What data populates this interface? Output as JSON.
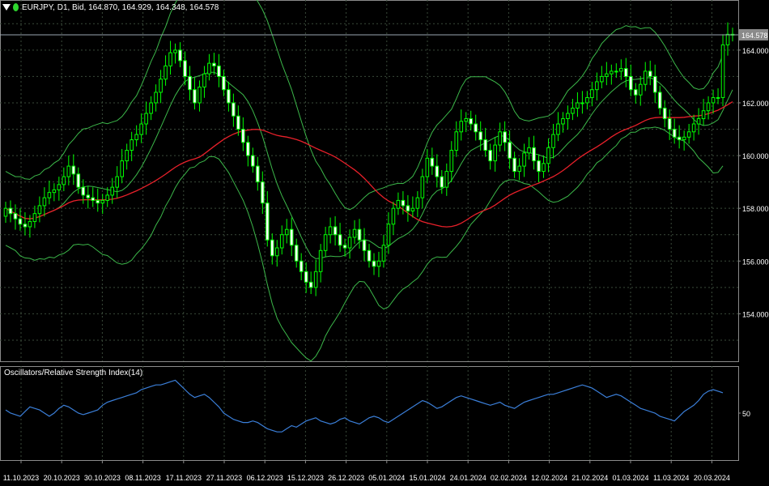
{
  "header": {
    "symbol": "EURJPY",
    "timeframe": "D1",
    "price_type": "Bid",
    "ohlc_text": "EURJPY, D1, Bid, 164.870, 164.929, 164.348, 164.578"
  },
  "oscillator_label": "Oscillators/Relative Strength Index(14)",
  "current_price_label": "164.578",
  "colors": {
    "background": "#000000",
    "grid": "#3a4a3a",
    "candle": "#00ff00",
    "bollinger": "#3cb84a",
    "ma": "#e8202a",
    "rsi": "#3b7fd9",
    "price_tag_bg": "#8a8a8a"
  },
  "chart_data": [
    {
      "type": "candlestick",
      "title": "EURJPY, D1, Bid",
      "ylim": [
        152.2,
        165.9
      ],
      "y_ticks": [
        154.0,
        156.0,
        158.0,
        160.0,
        162.0,
        164.0
      ],
      "y_tick_labels": [
        "154.000",
        "156.000",
        "158.000",
        "160.000",
        "162.000",
        "164.000"
      ],
      "x_tick_labels": [
        "11.10.2023",
        "20.10.2023",
        "30.10.2023",
        "08.11.2023",
        "17.11.2023",
        "27.11.2023",
        "06.12.2023",
        "15.12.2023",
        "26.12.2023",
        "05.01.2024",
        "15.01.2024",
        "24.01.2024",
        "02.02.2024",
        "12.02.2024",
        "21.02.2024",
        "01.03.2024",
        "11.03.2024",
        "20.03.2024"
      ],
      "grid": true,
      "close": [
        158.0,
        157.8,
        157.6,
        157.4,
        157.3,
        157.5,
        157.8,
        158.1,
        158.4,
        158.6,
        158.7,
        158.9,
        159.2,
        159.6,
        159.3,
        158.8,
        158.5,
        158.4,
        158.3,
        158.2,
        158.3,
        158.5,
        158.8,
        159.2,
        159.8,
        160.2,
        160.6,
        160.8,
        161.2,
        161.6,
        162.0,
        162.4,
        162.9,
        163.4,
        163.9,
        164.0,
        163.6,
        163.0,
        162.5,
        162.0,
        162.6,
        163.1,
        163.5,
        163.4,
        163.0,
        162.5,
        162.0,
        161.5,
        161.0,
        160.5,
        160.0,
        159.6,
        159.0,
        158.2,
        156.8,
        156.2,
        156.5,
        157.0,
        157.2,
        156.6,
        156.0,
        155.6,
        155.2,
        155.0,
        155.6,
        156.4,
        157.0,
        157.3,
        157.0,
        156.6,
        156.5,
        156.9,
        157.2,
        156.8,
        156.4,
        156.0,
        155.8,
        156.0,
        156.6,
        157.4,
        158.0,
        158.3,
        158.1,
        157.9,
        158.0,
        158.4,
        159.2,
        159.9,
        159.6,
        159.2,
        158.8,
        159.4,
        160.2,
        160.9,
        161.3,
        161.4,
        161.2,
        160.9,
        160.6,
        160.2,
        159.8,
        160.4,
        160.9,
        160.5,
        159.9,
        159.4,
        159.6,
        160.1,
        160.3,
        159.8,
        159.4,
        159.7,
        160.3,
        160.8,
        161.2,
        161.4,
        161.6,
        161.8,
        162.0,
        162.0,
        162.2,
        162.5,
        162.8,
        163.0,
        163.1,
        163.2,
        163.2,
        163.3,
        163.0,
        162.5,
        162.3,
        162.7,
        163.2,
        163.0,
        162.4,
        161.8,
        161.4,
        161.0,
        160.7,
        160.6,
        160.7,
        160.9,
        161.2,
        161.4,
        161.7,
        162.0,
        162.2,
        162.2,
        164.2,
        164.6,
        164.58
      ],
      "ma_values": [
        157.8,
        157.8,
        157.8,
        157.8,
        157.8,
        157.8,
        157.8,
        157.8,
        157.8,
        157.8,
        157.8,
        157.8,
        157.8,
        157.9,
        157.9,
        157.9,
        158.0,
        158.1,
        158.2,
        158.3,
        158.4,
        158.5,
        158.6,
        158.7,
        158.8,
        158.9,
        159.0,
        159.1,
        159.2,
        159.3,
        159.5,
        159.6,
        159.7,
        159.8,
        159.9,
        160.0,
        160.1,
        160.2,
        160.3,
        160.3,
        160.3,
        160.3,
        160.3,
        160.2,
        160.2,
        160.2,
        160.2,
        160.2,
        160.2,
        160.1,
        160.0,
        160.0,
        159.9,
        159.8,
        159.7,
        159.6,
        159.6,
        159.5,
        159.4,
        159.3,
        159.2,
        159.1,
        159.0,
        158.9,
        158.8,
        158.7,
        158.6,
        158.6,
        158.5,
        158.5,
        158.4,
        158.4,
        158.4,
        158.3,
        158.3,
        158.2,
        158.2,
        158.2,
        158.2,
        158.1,
        158.1,
        158.1,
        158.1,
        158.1,
        158.1,
        158.1,
        158.1,
        158.1,
        158.1,
        158.2,
        158.2,
        158.2,
        158.3,
        158.4,
        158.5,
        158.6,
        158.7,
        158.8,
        158.9,
        159.0,
        159.1,
        159.1,
        159.2,
        159.3,
        159.4,
        159.5,
        159.6,
        159.7,
        159.8,
        159.9,
        160.0,
        160.1,
        160.2,
        160.3,
        160.4,
        160.5,
        160.6,
        160.7,
        160.7,
        160.8,
        160.9,
        161.0,
        161.0,
        161.1,
        161.2,
        161.3,
        161.4,
        161.5,
        161.6,
        161.7,
        161.7,
        161.8,
        161.9,
        162.0,
        162.1,
        162.1,
        162.2,
        162.3,
        162.4,
        162.5,
        162.6,
        162.7,
        162.8,
        162.9,
        163.0,
        163.0,
        163.1,
        163.1,
        163.2,
        163.2,
        163.3,
        163.3
      ],
      "ma_series_note": "",
      "bollinger_width": [
        1.4,
        1.4,
        1.4,
        1.5,
        1.5,
        1.5,
        1.6,
        1.6,
        1.7,
        1.7,
        1.8,
        1.8,
        1.9,
        2.0,
        2.0,
        2.1,
        2.2,
        2.2,
        2.3,
        2.4,
        2.5,
        2.5,
        2.6,
        2.7,
        2.8,
        2.9,
        3.0,
        3.0,
        3.1,
        3.2,
        3.3,
        3.3,
        3.4,
        3.4,
        3.5,
        3.5,
        3.5,
        3.5,
        3.4,
        3.4,
        3.3,
        3.3,
        3.2,
        3.2,
        3.2,
        3.3,
        3.4,
        3.6,
        3.8,
        4.0,
        4.2,
        4.4,
        4.6,
        4.8,
        5.0,
        5.1,
        5.1,
        5.0,
        4.9,
        4.8,
        4.6,
        4.4,
        4.2,
        4.0,
        3.7,
        3.4,
        3.0,
        2.7,
        2.4,
        2.1,
        1.8,
        1.6,
        1.5,
        1.5,
        1.6,
        1.8,
        2.0,
        2.2,
        2.3,
        2.3,
        2.2,
        2.1,
        2.0,
        2.0,
        2.0,
        2.1,
        2.2,
        2.3,
        2.4,
        2.5,
        2.6,
        2.7,
        2.7,
        2.8,
        2.9,
        2.9,
        2.8,
        2.7,
        2.6,
        2.5,
        2.3,
        2.1,
        1.9,
        1.7,
        1.5,
        1.3,
        1.2,
        1.2,
        1.2,
        1.3,
        1.4,
        1.5,
        1.6,
        1.7,
        1.8,
        1.9,
        2.0,
        2.0,
        2.0,
        2.0,
        2.0,
        2.1,
        2.1,
        2.2,
        2.2,
        2.2,
        2.2,
        2.1,
        2.1,
        2.0,
        2.0,
        1.9,
        1.9,
        1.9,
        1.8,
        1.7,
        1.6,
        1.5,
        1.4,
        1.3,
        1.2,
        1.2,
        1.2,
        1.3,
        1.4,
        1.6,
        1.9,
        2.0,
        2.1
      ]
    },
    {
      "type": "line",
      "title": "Oscillators/Relative Strength Index(14)",
      "ylim": [
        20,
        80
      ],
      "y_ticks": [
        50
      ],
      "y_tick_labels": [
        "50"
      ],
      "series": [
        {
          "values": [
            52,
            50,
            49,
            48,
            51,
            54,
            53,
            52,
            50,
            48,
            50,
            53,
            55,
            54,
            52,
            50,
            49,
            50,
            51,
            52,
            55,
            57,
            58,
            59,
            60,
            61,
            62,
            63,
            65,
            66,
            67,
            68,
            68,
            69,
            70,
            71,
            68,
            65,
            62,
            60,
            61,
            62,
            60,
            57,
            54,
            50,
            48,
            46,
            45,
            44,
            44,
            45,
            44,
            42,
            40,
            39,
            38,
            38,
            40,
            42,
            41,
            43,
            45,
            46,
            47,
            45,
            44,
            43,
            44,
            46,
            47,
            45,
            44,
            43,
            45,
            47,
            48,
            47,
            45,
            44,
            46,
            48,
            50,
            52,
            54,
            56,
            58,
            57,
            55,
            53,
            54,
            56,
            58,
            60,
            61,
            60,
            59,
            58,
            57,
            56,
            55,
            56,
            57,
            55,
            54,
            53,
            55,
            57,
            58,
            59,
            60,
            61,
            62,
            62,
            63,
            64,
            65,
            66,
            67,
            68,
            67,
            66,
            64,
            62,
            60,
            61,
            62,
            61,
            59,
            57,
            55,
            53,
            52,
            51,
            50,
            48,
            47,
            46,
            45,
            48,
            51,
            53,
            55,
            58,
            62,
            64,
            65,
            64,
            63
          ]
        }
      ]
    }
  ]
}
